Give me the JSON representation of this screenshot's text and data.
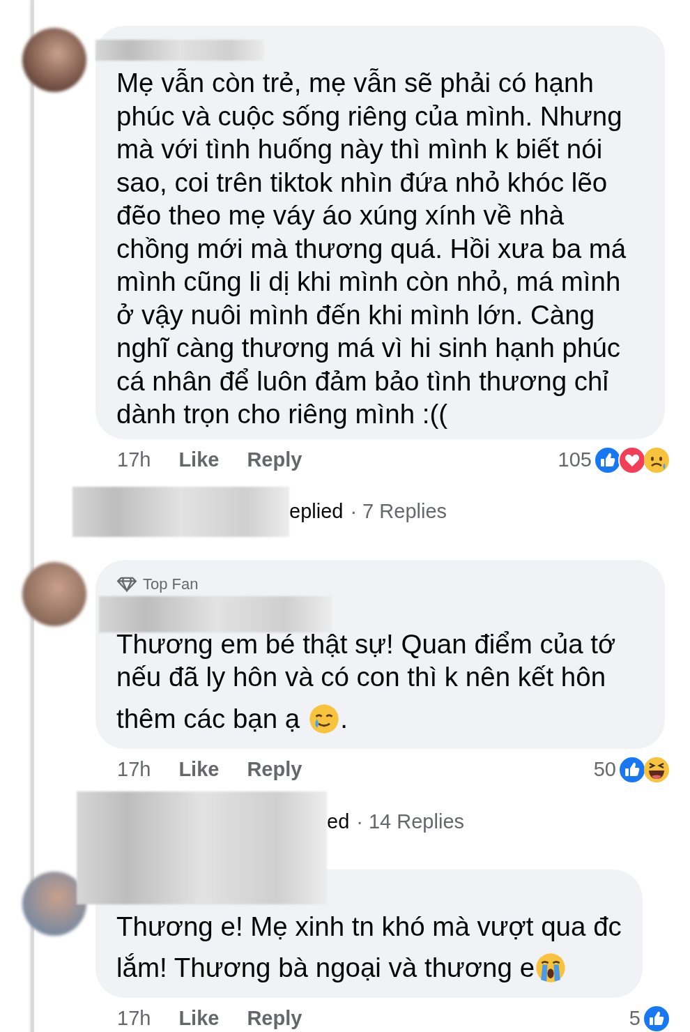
{
  "thread": [
    {
      "kind": "comment",
      "body": "Mẹ vẫn còn trẻ, mẹ vẫn sẽ phải có hạnh phúc và cuộc sống riêng của mình. Nhưng mà với tình huống này thì mình k biết nói sao, coi trên tiktok nhìn đứa nhỏ khóc lẽo đẽo theo mẹ váy áo xúng xính về nhà chồng mới mà thương quá. Hồi xưa ba má mình cũng li dị khi mình còn nhỏ, má mình ở vậy nuôi mình đến khi mình lớn. Càng nghĩ càng thương má vì hi sinh hạnh phúc cá nhân để luôn đảm bảo tình thương chỉ dành trọn cho riêng mình :((",
      "time": "17h",
      "like": "Like",
      "reply": "Reply",
      "reaction_count": "105",
      "reactions": [
        {
          "kind": "like"
        },
        {
          "kind": "love"
        },
        {
          "kind": "sad"
        }
      ]
    },
    {
      "kind": "replies",
      "fragment": "eplied",
      "summary": "· 7 Replies"
    },
    {
      "kind": "comment",
      "badge": "Top Fan",
      "body": "Thương em bé thật sự! Quan điểm của tớ nếu đã ly hôn và có con thì k nên kết hôn",
      "last_line": "thêm các bạn ạ",
      "emoji": {
        "kind": "tear-smile"
      },
      "tail": ".",
      "time": "17h",
      "like": "Like",
      "reply": "Reply",
      "reaction_count": "50",
      "reactions": [
        {
          "kind": "like"
        },
        {
          "kind": "haha"
        }
      ]
    },
    {
      "kind": "replies",
      "fragment": "ed",
      "summary": "· 14 Replies"
    },
    {
      "kind": "comment",
      "body": "Thương e! Mẹ xinh tn khó mà vượt qua đc",
      "last_line": "lắm! Thương bà ngoại và thương e",
      "emoji": {
        "kind": "loud-cry"
      },
      "time": "17h",
      "like": "Like",
      "reply": "Reply",
      "reaction_count": "5",
      "reactions": [
        {
          "kind": "like"
        }
      ]
    }
  ]
}
